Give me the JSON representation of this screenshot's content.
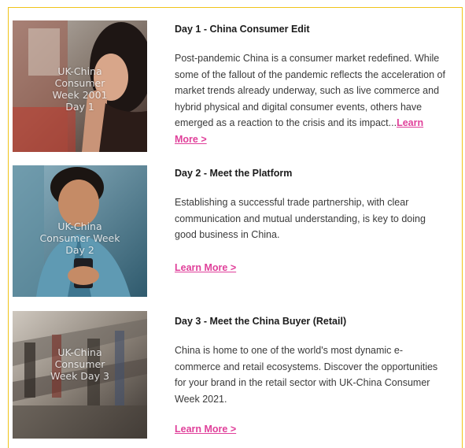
{
  "colors": {
    "border": "#f0c419",
    "link": "#e0409a",
    "title": "#1b1b1b",
    "body": "#3a3a3a"
  },
  "days": [
    {
      "image_caption": "UK-China\nConsumer\nWeek 2001\nDay 1",
      "title": "Day 1 - China Consumer Edit",
      "body": "Post-pandemic China is a consumer market redefined. While some of the fallout of the pandemic reflects the acceleration of market trends already underway, such as live commerce and hybrid physical and digital consumer events, others have emerged as a reaction to the crisis and its impact...",
      "link": "Learn More >"
    },
    {
      "image_caption": "UK-China\nConsumer Week\nDay 2",
      "title": "Day 2 - Meet the Platform",
      "body": "Establishing a successful trade partnership, with clear communication and mutual understanding, is key to doing good business in China.",
      "link": "Learn More >"
    },
    {
      "image_caption": "UK-China\nConsumer\nWeek  Day 3",
      "title": "Day 3 - Meet the China Buyer (Retail)",
      "body": "China is home to one of the world's most dynamic e-commerce and retail ecosystems. Discover the opportunities for your brand in the retail sector with UK-China Consumer Week 2021.",
      "link": "Learn More >"
    }
  ]
}
